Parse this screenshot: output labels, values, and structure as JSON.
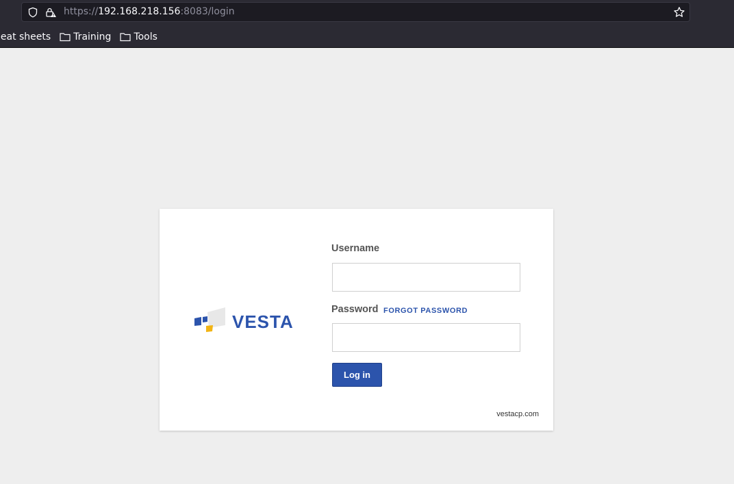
{
  "browser": {
    "url_scheme": "https://",
    "url_host": "192.168.218.156",
    "url_rest": ":8083/login",
    "bookmarks": [
      {
        "label": "heat sheets"
      },
      {
        "label": "Training"
      },
      {
        "label": "Tools"
      }
    ]
  },
  "login": {
    "logo_text": "VESTA",
    "username_label": "Username",
    "username_value": "",
    "password_label": "Password",
    "password_value": "",
    "forgot_label": "FORGOT PASSWORD",
    "submit_label": "Log in",
    "footer_link": "vestacp.com"
  },
  "colors": {
    "brand_blue": "#2c54ac",
    "logo_yellow": "#f2b414",
    "page_bg": "#eeeeee"
  }
}
